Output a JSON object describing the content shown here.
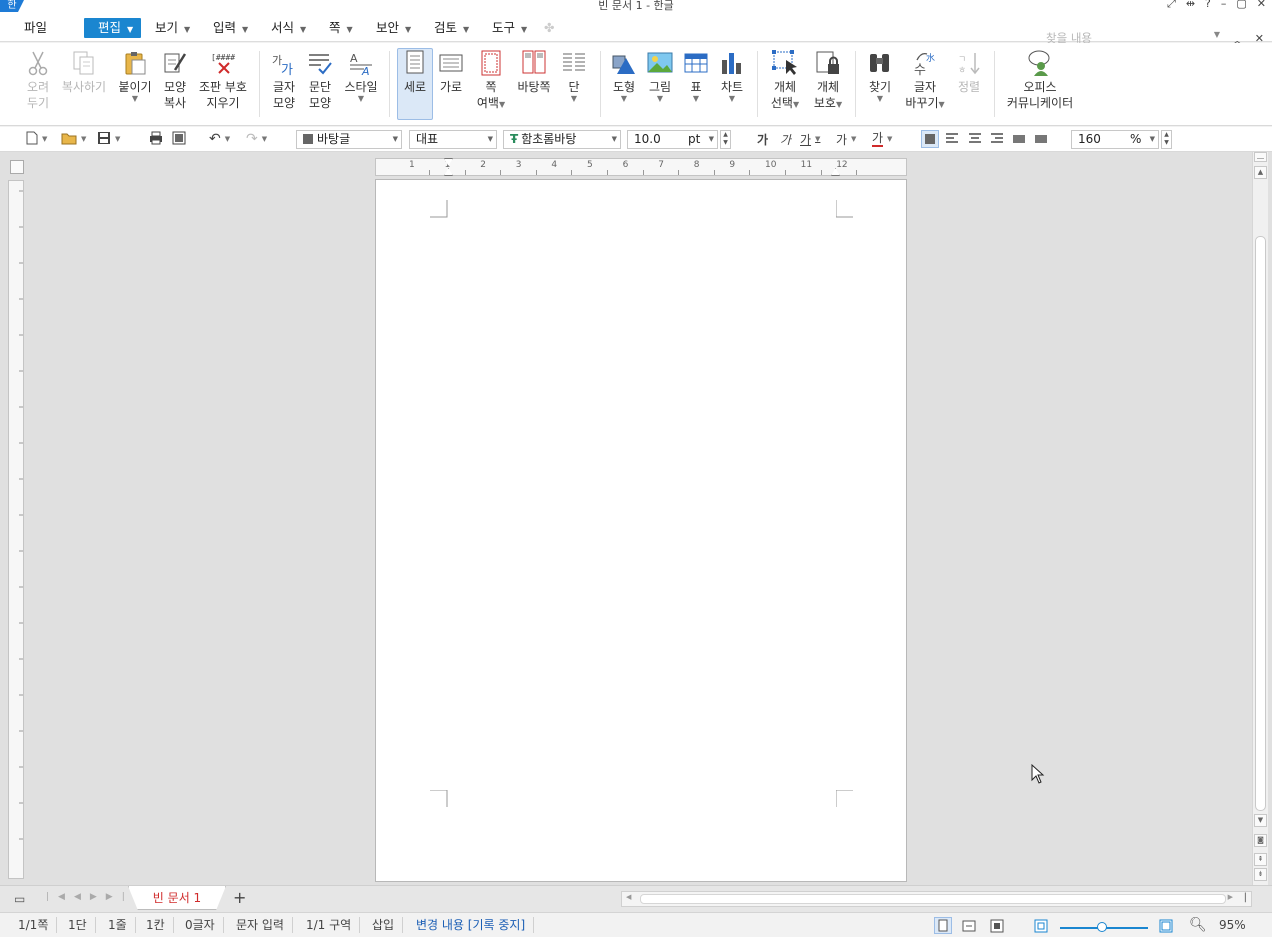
{
  "window": {
    "title": "빈 문서 1 - 한글",
    "logo": "한"
  },
  "menu": {
    "file": "파일",
    "items": [
      "편집",
      "보기",
      "입력",
      "서식",
      "쪽",
      "보안",
      "검토",
      "도구"
    ],
    "search_placeholder": "찾을 내용"
  },
  "ribbon": {
    "cut_l1": "오려",
    "cut_l2": "두기",
    "copy": "복사하기",
    "paste": "붙이기",
    "format_painter_l1": "모양",
    "format_painter_l2": "복사",
    "clear_marks_l1": "조판 부호",
    "clear_marks_l2": "지우기",
    "char_shape_l1": "글자",
    "char_shape_l2": "모양",
    "para_shape_l1": "문단",
    "para_shape_l2": "모양",
    "style": "스타일",
    "portrait": "세로",
    "landscape": "가로",
    "margin_l1": "쪽",
    "margin_l2": "여백",
    "master_page": "바탕쪽",
    "columns": "단",
    "shape": "도형",
    "picture": "그림",
    "table": "표",
    "chart": "차트",
    "obj_select_l1": "개체",
    "obj_select_l2": "선택",
    "obj_protect_l1": "개체",
    "obj_protect_l2": "보호",
    "find": "찾기",
    "replace_l1": "글자",
    "replace_l2": "바꾸기",
    "sort": "정렬",
    "office_l1": "오피스",
    "office_l2": "커뮤니케이터"
  },
  "format_bar": {
    "style_combo": "바탕글",
    "lang_combo": "대표",
    "font_combo": "함초롬바탕",
    "font_size": "10.0",
    "size_unit": "pt",
    "bold": "가",
    "italic": "가",
    "underline": "가",
    "strike": "가",
    "font_color": "가",
    "zoom": "160",
    "zoom_unit": "%"
  },
  "ruler": {
    "h_ticks": [
      "1",
      "1",
      "2",
      "3",
      "4",
      "5",
      "6",
      "7",
      "8",
      "9",
      "10",
      "11",
      "12"
    ]
  },
  "tabs": {
    "doc_tab": "빈 문서 1",
    "add": "+"
  },
  "status": {
    "page": "1/1쪽",
    "column": "1단",
    "line": "1줄",
    "col": "1칸",
    "chars": "0글자",
    "mode": "문자 입력",
    "section": "1/1 구역",
    "insert": "삽입",
    "track": "변경 내용 [기록 중지]",
    "zoom": "95%"
  },
  "colors": {
    "accent": "#1a86d0",
    "tab_text": "#d02b2b",
    "link": "#1c5fb5"
  }
}
